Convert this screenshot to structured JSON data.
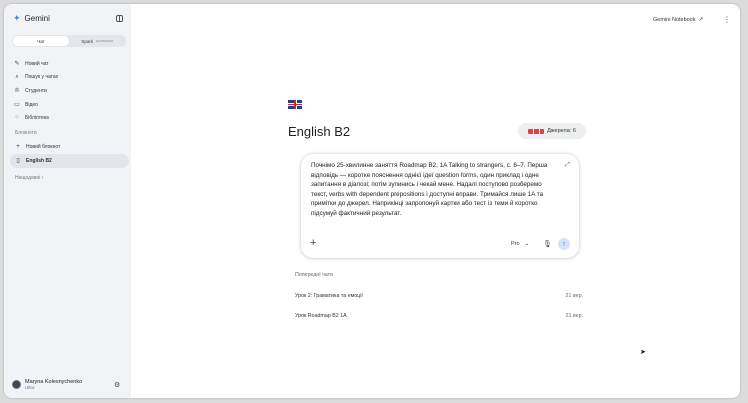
{
  "sidebar": {
    "brand": "Gemini",
    "toggle": {
      "chat": "Чат",
      "spark": "Spark",
      "spark_badge": "ЕКСПЕРИМ."
    },
    "nav": [
      {
        "icon": "edit-icon",
        "glyph": "✎",
        "label": "Новий чат"
      },
      {
        "icon": "search-icon",
        "glyph": "⌕",
        "label": "Пошук у чатах"
      },
      {
        "icon": "graduation-cap-icon",
        "glyph": "♔",
        "label": "Студенти"
      },
      {
        "icon": "video-icon",
        "glyph": "▭",
        "label": "Відео"
      },
      {
        "icon": "library-icon",
        "glyph": "⁘",
        "label": "Бібліотека"
      }
    ],
    "notebooks_title": "Блокноти",
    "notebooks": [
      {
        "icon": "plus-icon",
        "glyph": "+",
        "label": "Новий блокнот"
      },
      {
        "icon": "notebook-icon",
        "glyph": "▯",
        "label": "English B2"
      }
    ],
    "recent_label": "Нещодавні",
    "recent_chevron": "›",
    "user": {
      "name": "Maryna Kolesnychenko",
      "plan": "Ultra"
    }
  },
  "topbar": {
    "link": "Gemini Notebook",
    "link_icon": "↗",
    "more": "⋮"
  },
  "notebook": {
    "title": "English B2",
    "sources_label": "Джерела: 6"
  },
  "composer": {
    "text": "Почнімо 25-хвилинне заняття Roadmap B2, 1A Talking to strangers, с. 6–7. Перша відповідь — коротке пояснення однієї ідеї question forms, один приклад і одне запитання в діалозі; потім зупинись і чекай мене. Надалі поступово розберемо текст, verbs with dependent prepositions і доступні вправи. Тримайся лише 1A та примітки до джерел. Наприкінці запропонуй картки або тест із теми й коротко підсумуй фактичний результат.",
    "add": "+",
    "model": "Pro",
    "model_chevron": "⌄",
    "mic": "🎙",
    "send": "↑",
    "expand": "⤢"
  },
  "previous": {
    "title": "Попередні чати",
    "chats": [
      {
        "title": "Урок 2: Граматика та емоції",
        "date": "21 вер."
      },
      {
        "title": "Урок Roadmap B2 1A",
        "date": "21 вер."
      }
    ]
  }
}
